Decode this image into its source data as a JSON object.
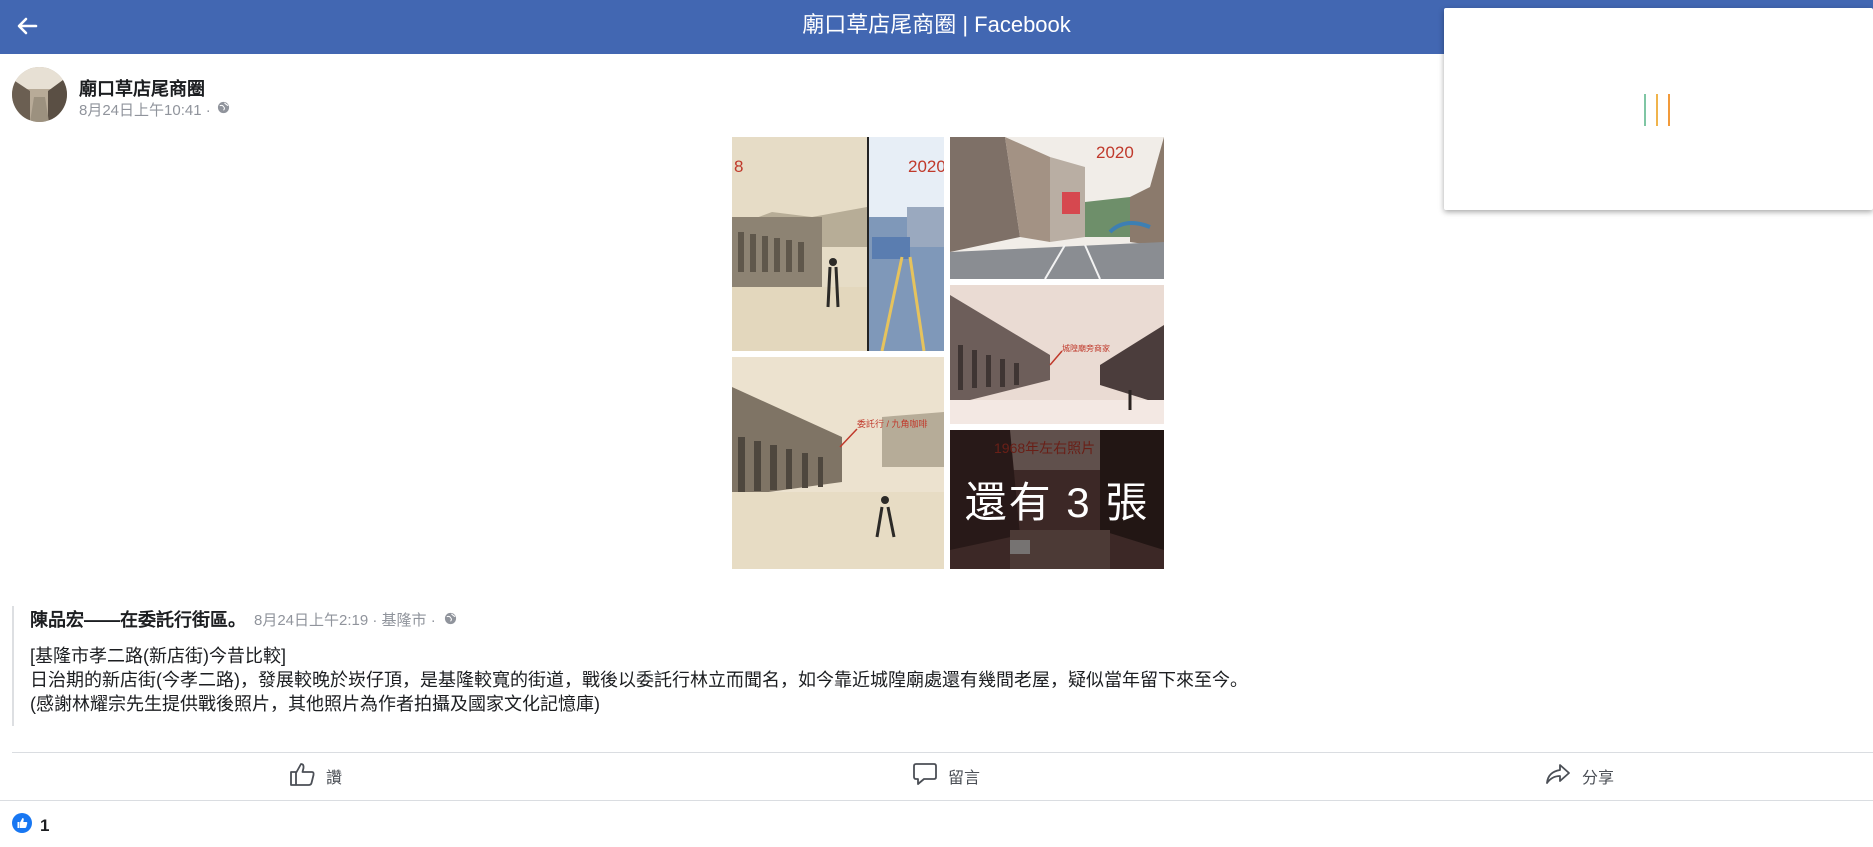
{
  "header": {
    "title": "廟口草店尾商圈 | Facebook"
  },
  "post": {
    "page_name": "廟口草店尾商圈",
    "timestamp": "8月24日上午10:41 ·",
    "privacy_icon": "globe-icon"
  },
  "photos": {
    "tags": {
      "photo1_left": "8",
      "photo1_right": "2020",
      "photo2": "2020",
      "photo3_caption": "城隍廟旁商家",
      "photo4_caption": "委託行 / 九角咖啡",
      "photo5_caption": "1968年左右照片"
    },
    "more_label": "還有 3 張"
  },
  "shared_post": {
    "author": "陳品宏",
    "location_phrase": "——在委託行街區。",
    "meta": "8月24日上午2:19 · 基隆市 ·",
    "lines": [
      "[基隆市孝二路(新店街)今昔比較]",
      "日治期的新店街(今孝二路)，發展較晚於崁仔頂，是基隆較寬的街道，戰後以委託行林立而聞名，如今靠近城隍廟處還有幾間老屋，疑似當年留下來至今。",
      "(感謝林耀宗先生提供戰後照片，其他照片為作者拍攝及國家文化記憶庫)"
    ]
  },
  "actions": {
    "like": "讚",
    "comment": "留言",
    "share": "分享"
  },
  "reactions": {
    "count": "1"
  },
  "colors": {
    "header_bg": "#4267b2",
    "meta_text": "#90949c",
    "like_blue": "#1877f2"
  }
}
